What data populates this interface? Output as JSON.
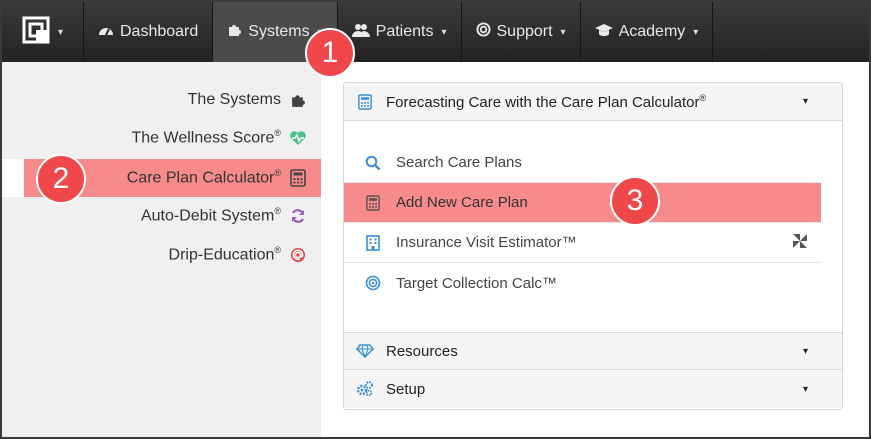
{
  "navbar": {
    "items": [
      {
        "label": "Dashboard",
        "icon": "tachometer-icon"
      },
      {
        "label": "Systems",
        "icon": "puzzle-icon",
        "caret": "▾"
      },
      {
        "label": "Patients",
        "icon": "users-icon",
        "caret": "▾"
      },
      {
        "label": "Support",
        "icon": "lifebuoy-icon",
        "caret": "▾"
      },
      {
        "label": "Academy",
        "icon": "graduation-cap-icon",
        "caret": "▾"
      }
    ],
    "logo_caret": "▾"
  },
  "sidebar": {
    "items": [
      {
        "label": "The Systems",
        "reg": "",
        "icon": "puzzle-icon"
      },
      {
        "label": "The Wellness Score",
        "reg": "®",
        "icon": "heartbeat-icon"
      },
      {
        "label": "Care Plan Calculator",
        "reg": "®",
        "icon": "calculator-icon"
      },
      {
        "label": "Auto-Debit System",
        "reg": "®",
        "icon": "refresh-icon"
      },
      {
        "label": "Drip-Education",
        "reg": "®",
        "icon": "at-sign-icon"
      }
    ]
  },
  "panel": {
    "header": {
      "label": "Forecasting Care with the Care Plan Calculator",
      "reg": "®",
      "caret": "▾"
    },
    "rows": [
      {
        "label": "Search Care Plans",
        "icon": "search-icon"
      },
      {
        "label": "Add New Care Plan",
        "icon": "calculator-icon"
      },
      {
        "label": "Insurance Visit Estimator™",
        "icon": "building-icon"
      },
      {
        "label": "Target Collection Calc™",
        "icon": "target-icon"
      }
    ],
    "resources": {
      "label": "Resources",
      "caret": "▾"
    },
    "setup": {
      "label": "Setup",
      "caret": "▾"
    }
  },
  "badges": [
    "1",
    "2",
    "3"
  ],
  "colors": {
    "navbar": "#2b2b2b",
    "highlight": "#f78b8b",
    "badge": "#f0474a",
    "accent_blue": "#3a8fd6",
    "heart_green": "#4cc08a",
    "refresh_purple": "#9a5cc9",
    "at_red": "#e4473c"
  }
}
